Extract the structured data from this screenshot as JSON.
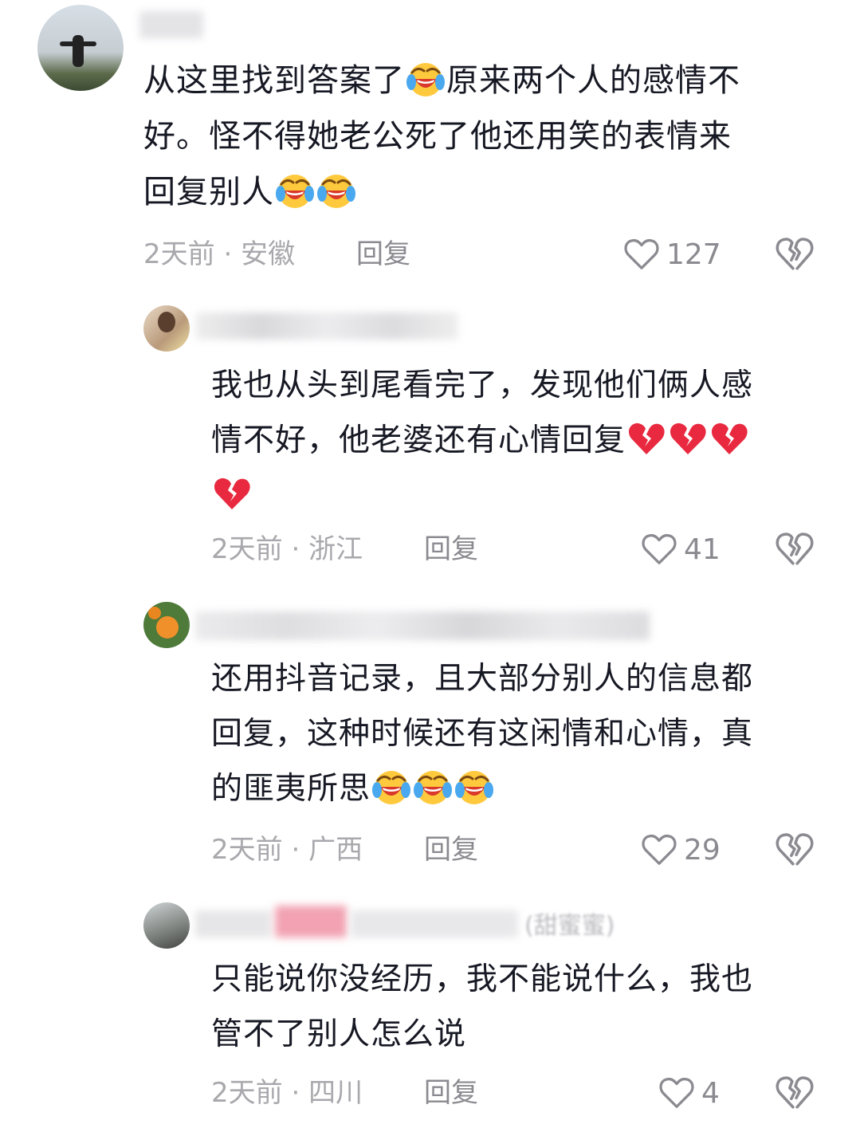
{
  "comments": [
    {
      "text_lines": [
        "从这里找到答案了",
        "原来两个人的感情不",
        "好。怪不得她老公死了他还用笑的表情来",
        "回复别人"
      ],
      "time": "2天前",
      "location": "安徽",
      "reply_label": "回复",
      "likes": "127"
    },
    {
      "text_lines": [
        "我也从头到尾看完了，发现他们俩人感",
        "情不好，他老婆还有心情回复"
      ],
      "time": "2天前",
      "location": "浙江",
      "reply_label": "回复",
      "likes": "41"
    },
    {
      "text_lines": [
        "还用抖音记录，且大部分别人的信息都",
        "回复，这种时候还有这闲情和心情，真",
        "的匪夷所思"
      ],
      "time": "2天前",
      "location": "广西",
      "reply_label": "回复",
      "likes": "29"
    },
    {
      "username_suffix": "(甜蜜蜜)",
      "text_lines": [
        "只能说你没经历，我不能说什么，我也",
        "管不了别人怎么说"
      ],
      "time": "2天前",
      "location": "四川",
      "reply_label": "回复",
      "likes": "4"
    }
  ],
  "separator": " · ",
  "icons": {
    "laugh_cry": "tears-of-joy-emoji",
    "broken_heart": "broken-heart-emoji",
    "like": "heart-outline-icon",
    "dislike": "broken-heart-outline-icon"
  },
  "colors": {
    "text": "#161823",
    "meta": "#a8a8ad",
    "broken_heart": "#e8293f",
    "emoji_face": "#ffc93d"
  }
}
